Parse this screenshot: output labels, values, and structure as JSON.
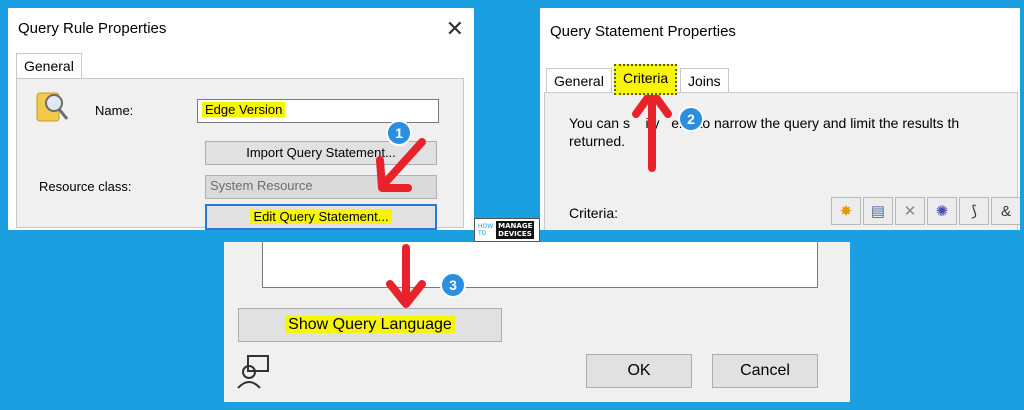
{
  "panel1": {
    "title": "Query Rule Properties",
    "close_glyph": "✕",
    "tab_general": "General",
    "name_label": "Name:",
    "name_value": "Edge Version",
    "import_button": "Import Query Statement...",
    "resource_class_label": "Resource class:",
    "resource_class_value": "System Resource",
    "edit_button": "Edit Query Statement..."
  },
  "panel2": {
    "title": "Query Statement Properties",
    "tabs": [
      "General",
      "Criteria",
      "Joins"
    ],
    "description_line1": "You can s    ify   eria to narrow the query and limit the results th",
    "description_line2": "returned.",
    "criteria_label": "Criteria:",
    "toolbar_glyphs": [
      "✸",
      "▤",
      "✕",
      "✺",
      "⟆",
      "&"
    ]
  },
  "panel3": {
    "show_query_button": "Show Query Language",
    "ok_button": "OK",
    "cancel_button": "Cancel"
  },
  "badges": [
    "1",
    "2",
    "3"
  ],
  "logo": {
    "line1": "HOW",
    "line2": "TO",
    "word1": "MANAGE",
    "word2": "DEVICES"
  },
  "colors": {
    "background": "#1a9fe0",
    "highlight": "#f8f500",
    "arrow": "#e8222a",
    "badge": "#2b8ee0",
    "focus": "#2b79d6"
  }
}
